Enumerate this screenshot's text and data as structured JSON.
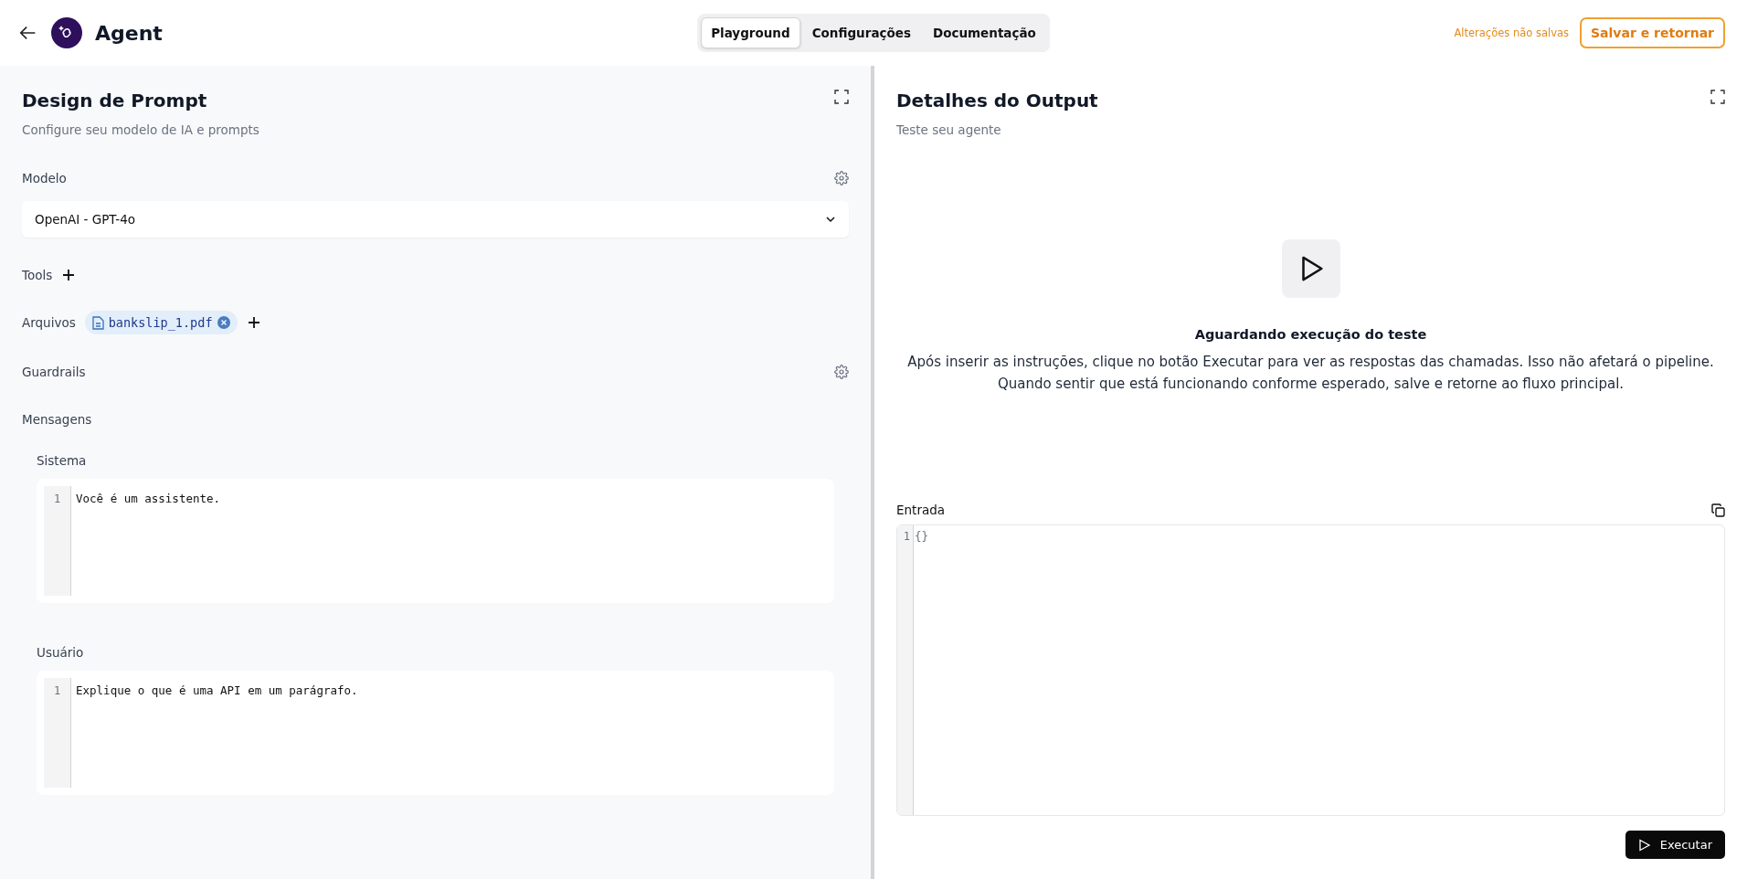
{
  "header": {
    "title": "Agent",
    "tabs": [
      {
        "label": "Playground",
        "selected": true
      },
      {
        "label": "Configurações",
        "selected": false
      },
      {
        "label": "Documentação",
        "selected": false
      }
    ],
    "unsaved_notice": "Alterações não salvas",
    "save_button": "Salvar e retornar"
  },
  "prompt_panel": {
    "title": "Design de Prompt",
    "subtitle": "Configure seu modelo de IA e prompts",
    "model_label": "Modelo",
    "model_value": "OpenAI - GPT-4o",
    "tools_label": "Tools",
    "files_label": "Arquivos",
    "files": [
      "bankslip_1.pdf"
    ],
    "guardrails_label": "Guardrails",
    "messages_label": "Mensagens",
    "messages": [
      {
        "role": "Sistema",
        "lines": [
          {
            "number": "1",
            "text": "Você é um assistente."
          }
        ]
      },
      {
        "role": "Usuário",
        "lines": [
          {
            "number": "1",
            "text": "Explique o que é uma API em um parágrafo."
          }
        ]
      }
    ]
  },
  "output_panel": {
    "title": "Detalhes do Output",
    "subtitle": "Teste seu agente",
    "empty_title": "Aguardando execução do teste",
    "empty_text": "Após inserir as instruções, clique no botão Executar para ver as respostas das chamadas. Isso não afetará o pipeline. Quando sentir que está funcionando conforme esperado, salve e retorne ao fluxo principal.",
    "input_label": "Entrada",
    "input_lines": [
      {
        "number": "1",
        "text": "{}"
      }
    ],
    "run_button": "Executar"
  }
}
